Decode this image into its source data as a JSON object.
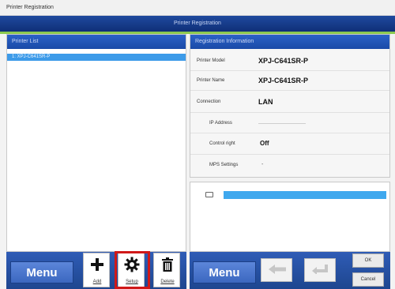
{
  "window": {
    "title": "Printer Registration",
    "header": "Printer Registration"
  },
  "left_panel": {
    "heading": "Printer List",
    "selected_printer": "1: XPJ-C641SR-P"
  },
  "right_panel": {
    "heading": "Registration Information",
    "printer_model_label": "Printer Model",
    "printer_model_value": "XPJ-C641SR-P",
    "printer_name_label": "Printer Name",
    "printer_name_value": "XPJ-C641SR-P",
    "connection_label": "Connection",
    "connection_value": "LAN",
    "ip_address_label": "IP Address",
    "control_right_label": "Control right",
    "control_right_value": "Off",
    "mps_settings_label": "MPS Settings",
    "mps_settings_value": "-"
  },
  "toolbar_left": {
    "menu_label": "Menu",
    "add_label": "Add",
    "setup_label": "Setup",
    "delete_label": "Delete",
    "add_icon": "plus-icon",
    "setup_icon": "gear-icon",
    "delete_icon": "trash-icon"
  },
  "toolbar_right": {
    "menu_label": "Menu",
    "ok_label": "OK",
    "cancel_label": "Cancel"
  },
  "colors": {
    "header_blue": "#1f4a9e",
    "selection_blue": "#3d9be9",
    "accent_green": "#8cc94f",
    "highlight_red": "#d01818"
  }
}
